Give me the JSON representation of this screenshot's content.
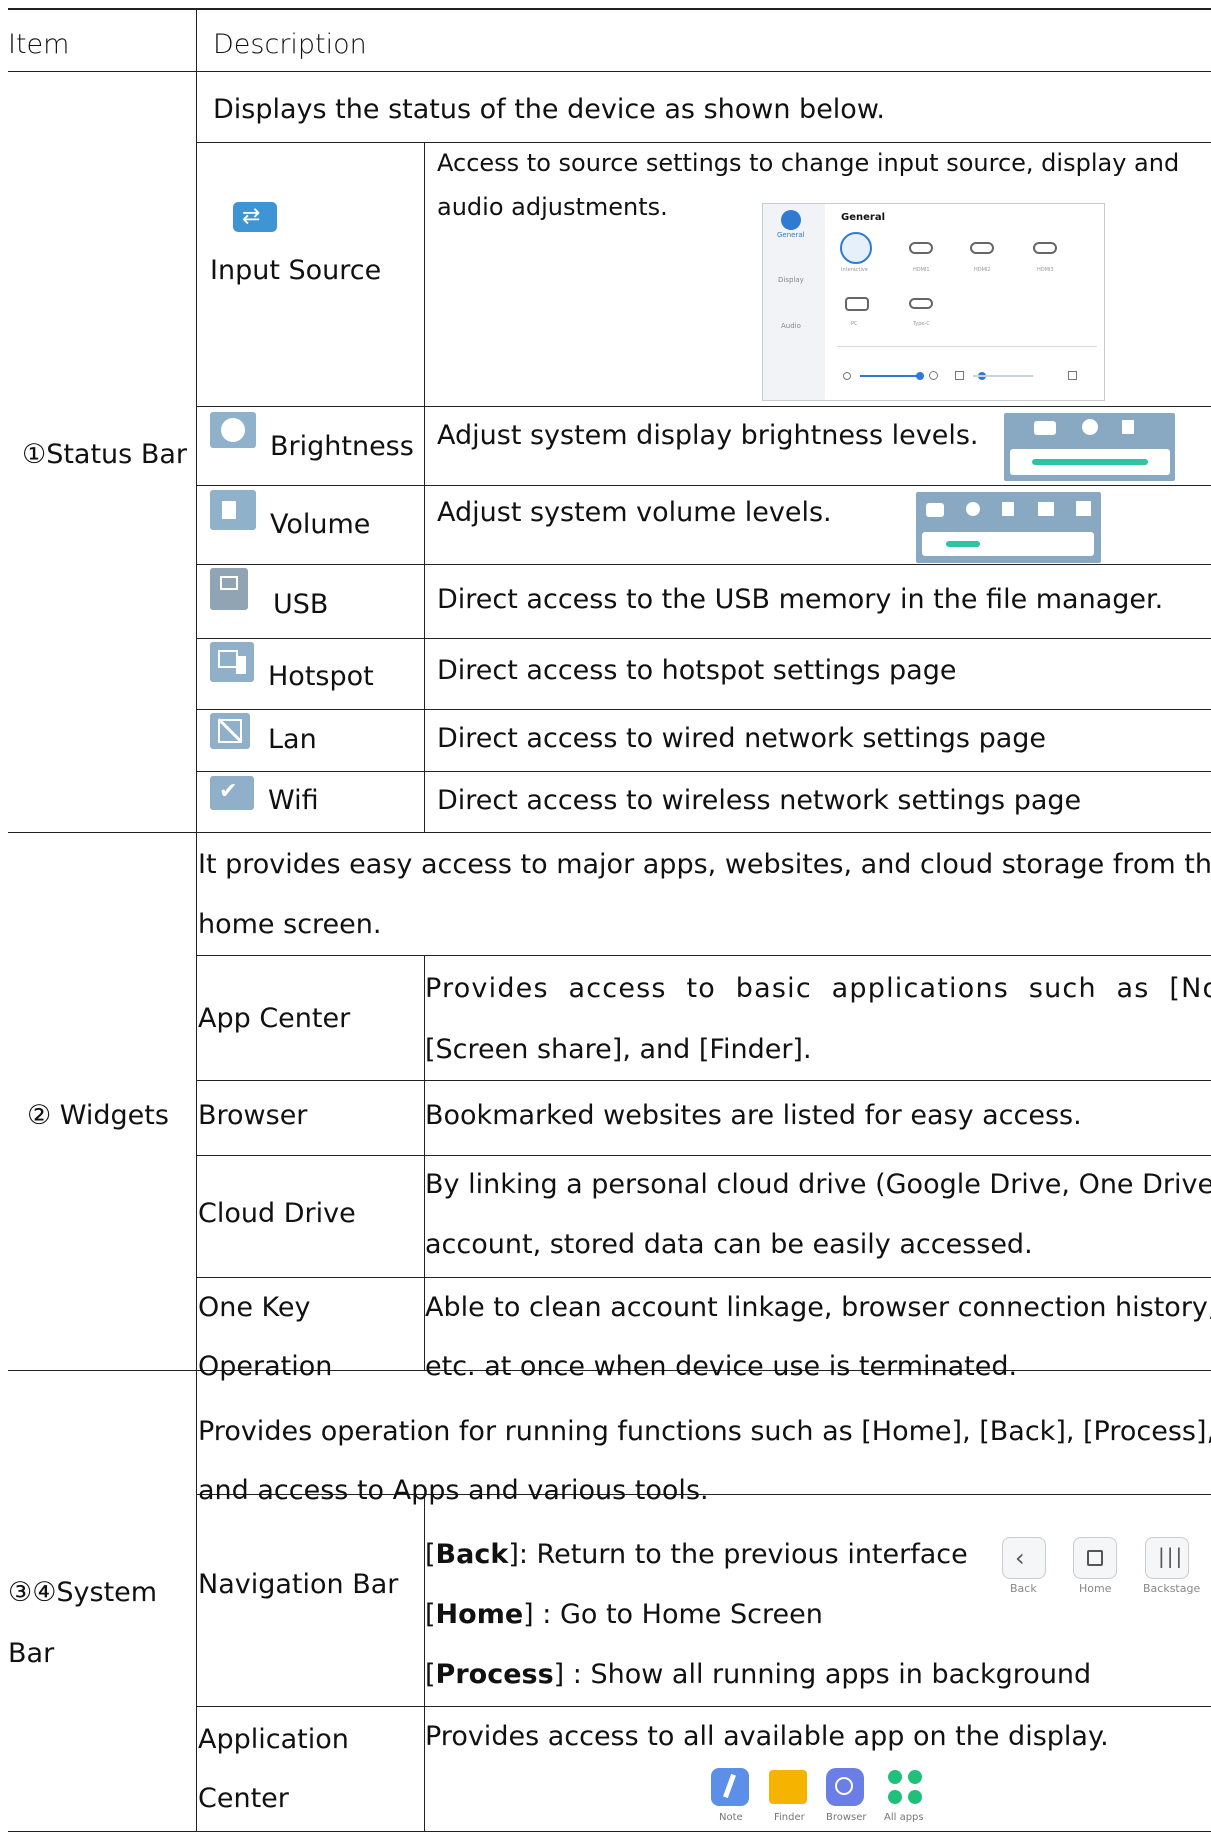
{
  "header": {
    "item": "Item",
    "description": "Description"
  },
  "status_bar": {
    "label": "①Status Bar",
    "intro": "Displays the status of the device as shown below.",
    "rows": [
      {
        "name": "Input Source",
        "desc_line1": "Access to source settings to change input source, display and",
        "desc_line2": "audio adjustments."
      },
      {
        "name": "Brightness",
        "desc": "Adjust system display brightness levels."
      },
      {
        "name": "Volume",
        "desc": "Adjust system volume levels."
      },
      {
        "name": "USB",
        "desc": "Direct access to the USB memory in the file manager."
      },
      {
        "name": "Hotspot",
        "desc": "Direct access to hotspot settings page"
      },
      {
        "name": "Lan",
        "desc": "Direct access to wired network settings page"
      },
      {
        "name": "Wifi",
        "desc": "Direct access to wireless network settings page"
      }
    ],
    "source_shot": {
      "sidebar": [
        "General",
        "Display",
        "Audio"
      ],
      "heading": "General",
      "sources": [
        "Interactive",
        "HDMI1",
        "HDMI2",
        "HDMI3",
        "PC",
        "Type-C"
      ]
    }
  },
  "widgets": {
    "label": "② Widgets",
    "intro_line1": "It provides easy access to major apps, websites, and cloud storage from the",
    "intro_line2": "home screen.",
    "rows": [
      {
        "name": "App Center",
        "desc_line1": "Provides access to basic applications such as [Note],",
        "desc_line2": "[Screen share], and [Finder]."
      },
      {
        "name": "Browser",
        "desc_line1": "Bookmarked websites are listed for easy access."
      },
      {
        "name": "Cloud Drive",
        "desc_line1": "By linking a personal cloud drive (Google Drive, One Drive)",
        "desc_line2": "account, stored data can be easily accessed."
      },
      {
        "name_line1": "One Key",
        "name_line2": "Operation",
        "desc_line1": "Able to clean account linkage, browser connection history,",
        "desc_line2": "etc. at once when device use is terminated."
      }
    ]
  },
  "system_bar": {
    "label_line1": "③④System",
    "label_line2": "Bar",
    "intro_line1": "Provides operation for running functions such as [Home], [Back], [Process],",
    "intro_line2": "and access to Apps and various tools.",
    "nav": {
      "name": "Navigation Bar",
      "back_key": "Back",
      "back_desc": ": Return to the previous interface",
      "home_key": "Home",
      "home_desc": " : Go to Home Screen",
      "process_key": "Process",
      "process_desc": " : Show all running apps in background",
      "buttons": [
        "Back",
        "Home",
        "Backstage"
      ]
    },
    "app_center": {
      "name_line1": "Application",
      "name_line2": "Center",
      "desc": "Provides access to all available app on the display.",
      "apps": [
        "Note",
        "Finder",
        "Browser",
        "All apps"
      ]
    }
  }
}
